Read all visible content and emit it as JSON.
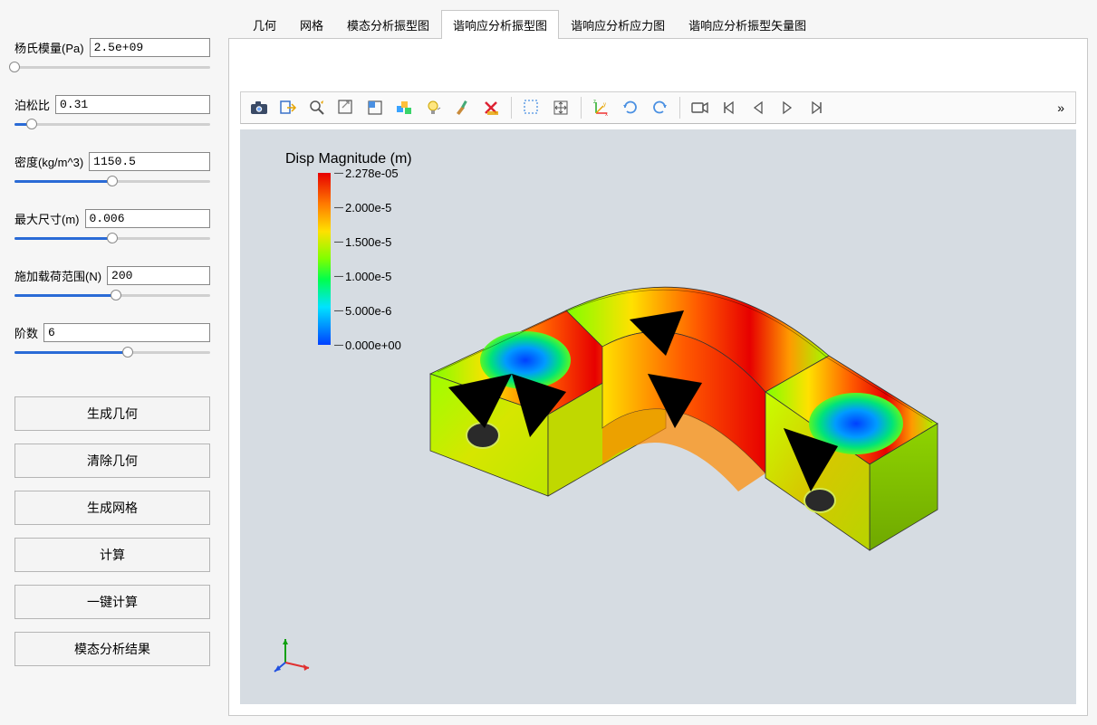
{
  "sidebar": {
    "params": [
      {
        "label": "杨氏模量(Pa)",
        "value": "2.5e+09",
        "fill": 0.0
      },
      {
        "label": "泊松比",
        "value": "0.31",
        "fill": 0.09
      },
      {
        "label": "密度(kg/m^3)",
        "value": "1150.5",
        "fill": 0.5
      },
      {
        "label": "最大尺寸(m)",
        "value": "0.006",
        "fill": 0.5
      },
      {
        "label": "施加载荷范围(N)",
        "value": "200",
        "fill": 0.52
      },
      {
        "label": "阶数",
        "value": "6",
        "fill": 0.58
      }
    ],
    "buttons": [
      "生成几何",
      "清除几何",
      "生成网格",
      "计算",
      "一键计算",
      "模态分析结果"
    ]
  },
  "tabs": {
    "items": [
      "几何",
      "网格",
      "模态分析振型图",
      "谐响应分析振型图",
      "谐响应分析应力图",
      "谐响应分析振型矢量图"
    ],
    "active_index": 3
  },
  "toolbar": {
    "more": "»",
    "icons": [
      "camera-icon",
      "export-icon",
      "zoom-fit-icon",
      "zoom-box-icon",
      "view-box-icon",
      "color-cubes-icon",
      "bulb-icon",
      "brush-icon",
      "delete-x-icon",
      "select-icon",
      "move-icon",
      "axis-icon",
      "rotate-cw-icon",
      "rotate-ccw-icon",
      "video-icon",
      "skip-back-icon",
      "play-back-icon",
      "play-forward-icon",
      "skip-forward-icon"
    ]
  },
  "legend": {
    "title": "Disp Magnitude (m)",
    "ticks": [
      "2.278e-05",
      "2.000e-5",
      "1.500e-5",
      "1.000e-5",
      "5.000e-6",
      "0.000e+00"
    ]
  },
  "chart_data": {
    "type": "heatmap",
    "title": "Disp Magnitude (m)",
    "colormap": "rainbow",
    "range": [
      0.0,
      2.278e-05
    ],
    "ticks": [
      0.0,
      5e-06,
      1e-05,
      1.5e-05,
      2e-05,
      2.278e-05
    ],
    "note": "3D FEA displacement magnitude contour on a half-clamp bracket geometry. Peak (red ~2.278e-05 m) occurs along the top arch; two bolt-hole bosses show minima (blue ~0 m)."
  }
}
